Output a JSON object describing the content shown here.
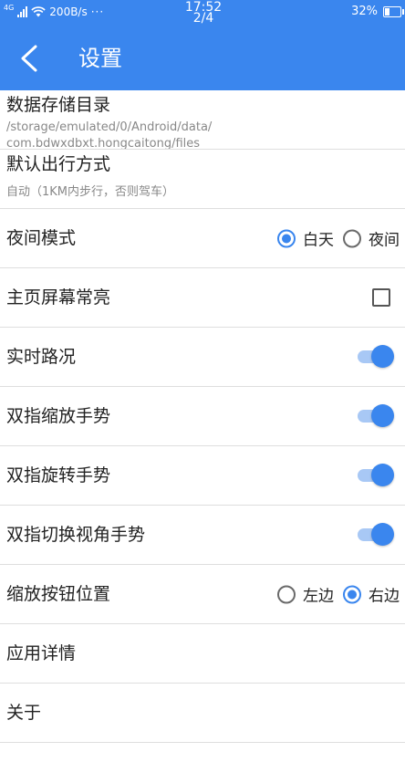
{
  "status_bar": {
    "network": "4G",
    "speed": "200B/s",
    "dots": "···",
    "time": "17:52",
    "page_indicator": "2/4",
    "battery": "32%",
    "battery_level": 0.32
  },
  "header": {
    "title": "设置"
  },
  "settings": {
    "storage": {
      "title": "数据存储目录",
      "path_line1": "/storage/emulated/0/Android/data/",
      "path_line2": "com.bdwxdbxt.hongcaitong/files"
    },
    "travel_mode": {
      "title": "默认出行方式",
      "subtitle": "自动（1KM内步行，否则驾车）"
    },
    "night_mode": {
      "title": "夜间模式",
      "options": [
        "白天",
        "夜间"
      ],
      "selected": "白天"
    },
    "screen_on": {
      "title": "主页屏幕常亮",
      "checked": false
    },
    "traffic": {
      "title": "实时路况",
      "on": true
    },
    "pinch_zoom": {
      "title": "双指缩放手势",
      "on": true
    },
    "rotate": {
      "title": "双指旋转手势",
      "on": true
    },
    "tilt": {
      "title": "双指切换视角手势",
      "on": true
    },
    "zoom_position": {
      "title": "缩放按钮位置",
      "options": [
        "左边",
        "右边"
      ],
      "selected": "右边"
    },
    "app_info": {
      "title": "应用详情"
    },
    "about": {
      "title": "关于"
    }
  },
  "colors": {
    "accent": "#3a86ee",
    "track": "#a8c8f5"
  }
}
